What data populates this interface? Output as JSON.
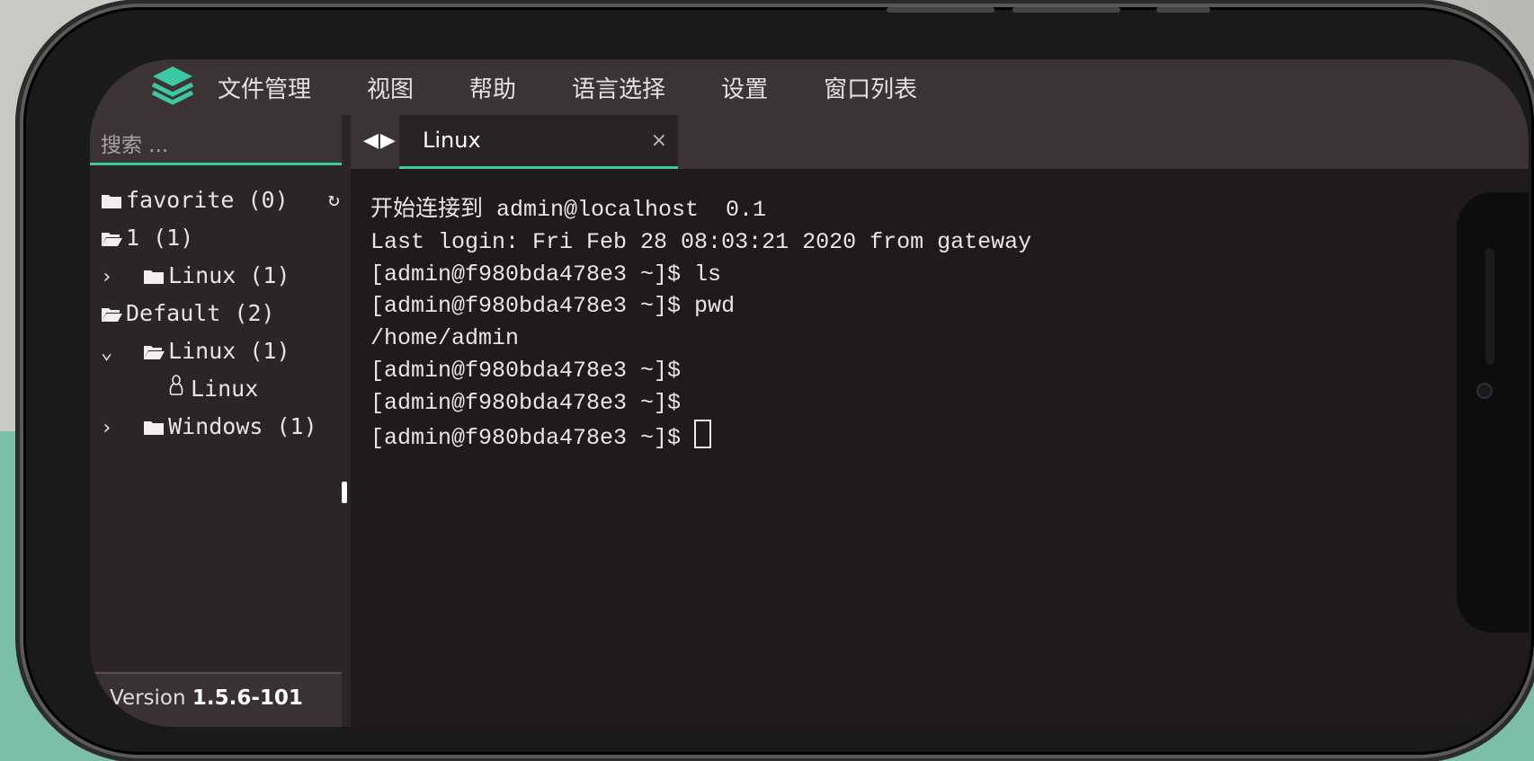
{
  "menu": {
    "items": [
      "文件管理",
      "视图",
      "帮助",
      "语言选择",
      "设置",
      "窗口列表"
    ]
  },
  "search": {
    "placeholder": "搜索 ..."
  },
  "tree": {
    "favorite": "favorite (0)",
    "group1": "1 (1)",
    "group1_linux": "Linux (1)",
    "default": "Default (2)",
    "default_linux": "Linux (1)",
    "default_linux_host": "Linux",
    "windows": "Windows (1)"
  },
  "version": {
    "prefix": "Version",
    "number": "1.5.6-101"
  },
  "tabs": [
    {
      "label": "Linux",
      "close": "×"
    }
  ],
  "terminal": {
    "lines": [
      "开始连接到 admin@localhost  0.1",
      "Last login: Fri Feb 28 08:03:21 2020 from gateway",
      "[admin@f980bda478e3 ~]$ ls",
      "[admin@f980bda478e3 ~]$ pwd",
      "/home/admin",
      "[admin@f980bda478e3 ~]$",
      "[admin@f980bda478e3 ~]$",
      "[admin@f980bda478e3 ~]$ "
    ]
  },
  "colors": {
    "accent": "#3ec7a3",
    "menubar": "#3c3434",
    "terminal_bg": "#201b1b"
  }
}
